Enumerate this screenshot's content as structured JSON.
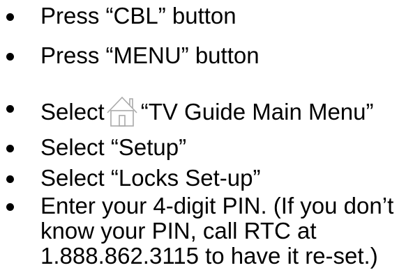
{
  "steps": [
    {
      "text": "Press “CBL” button"
    },
    {
      "text": "Press “MENU” button"
    },
    {
      "text_before": "Select",
      "icon": "home-icon",
      "text_after": "“TV Guide Main Menu”"
    },
    {
      "text": "Select “Setup”"
    },
    {
      "text": "Select “Locks Set-up”"
    },
    {
      "lines": [
        "Enter your 4-digit PIN. (If you don’t",
        "know your PIN, call RTC at",
        "1.888.862.3115 to have it re-set.)"
      ]
    }
  ]
}
